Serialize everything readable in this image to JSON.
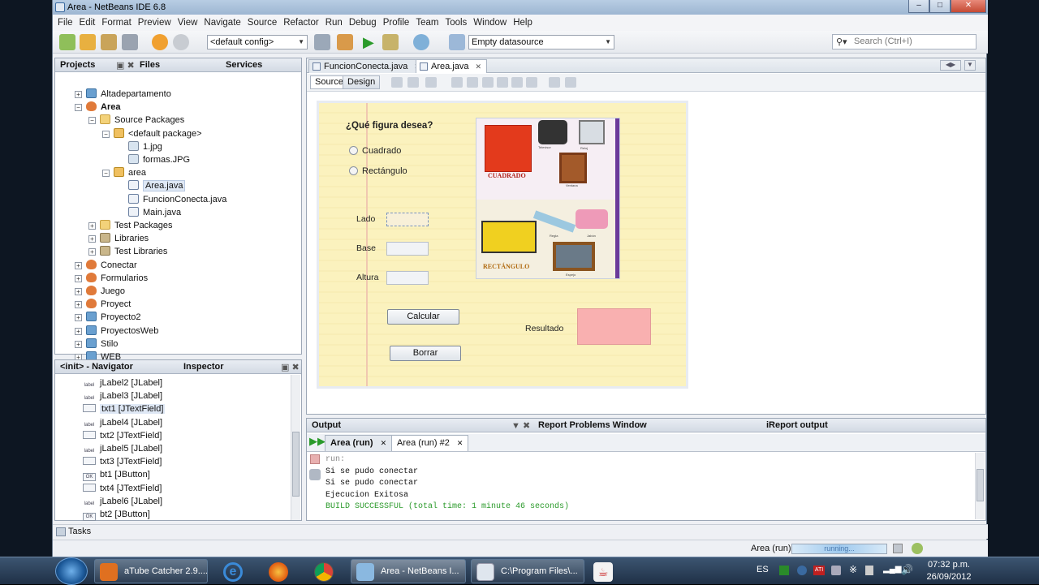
{
  "window": {
    "title": "Area - NetBeans IDE 6.8"
  },
  "menu": [
    "File",
    "Edit",
    "Format",
    "Preview",
    "View",
    "Navigate",
    "Source",
    "Refactor",
    "Run",
    "Debug",
    "Profile",
    "Team",
    "Tools",
    "Window",
    "Help"
  ],
  "toolbar": {
    "config": "<default config>",
    "datasource": "Empty datasource",
    "search_placeholder": "Search (Ctrl+I)"
  },
  "projects_panel": {
    "tabs": [
      "Projects",
      "Files",
      "Services"
    ],
    "tree": [
      {
        "label": "Altadepartamento",
        "icon": "project-icon"
      },
      {
        "label": "Area",
        "icon": "coffee-cup-icon",
        "bold": true
      },
      {
        "label": "Source Packages",
        "icon": "source-packages-icon"
      },
      {
        "label": "<default package>",
        "icon": "package-icon"
      },
      {
        "label": "1.jpg",
        "icon": "image-file-icon"
      },
      {
        "label": "formas.JPG",
        "icon": "image-file-icon"
      },
      {
        "label": "area",
        "icon": "package-icon"
      },
      {
        "label": "Area.java",
        "icon": "java-file-icon",
        "selected": true
      },
      {
        "label": "FuncionConecta.java",
        "icon": "java-file-icon"
      },
      {
        "label": "Main.java",
        "icon": "java-file-icon"
      },
      {
        "label": "Test Packages",
        "icon": "test-packages-icon"
      },
      {
        "label": "Libraries",
        "icon": "libraries-icon"
      },
      {
        "label": "Test Libraries",
        "icon": "libraries-icon"
      },
      {
        "label": "Conectar",
        "icon": "coffee-cup-icon"
      },
      {
        "label": "Formularios",
        "icon": "coffee-cup-icon"
      },
      {
        "label": "Juego",
        "icon": "coffee-cup-icon"
      },
      {
        "label": "Proyect",
        "icon": "coffee-cup-icon"
      },
      {
        "label": "Proyecto2",
        "icon": "project-icon"
      },
      {
        "label": "ProyectosWeb",
        "icon": "project-icon"
      },
      {
        "label": "Stilo",
        "icon": "project-icon"
      },
      {
        "label": "WEB",
        "icon": "project-icon"
      }
    ]
  },
  "navigator": {
    "tabs": [
      "<init> - Navigator",
      "Inspector"
    ],
    "items": [
      {
        "label": "jLabel2 [JLabel]",
        "icon": "label-icon"
      },
      {
        "label": "jLabel3 [JLabel]",
        "icon": "label-icon"
      },
      {
        "label": "txt1 [JTextField]",
        "icon": "textfield-icon",
        "selected": true
      },
      {
        "label": "jLabel4 [JLabel]",
        "icon": "label-icon"
      },
      {
        "label": "txt2 [JTextField]",
        "icon": "textfield-icon"
      },
      {
        "label": "jLabel5 [JLabel]",
        "icon": "label-icon"
      },
      {
        "label": "txt3 [JTextField]",
        "icon": "textfield-icon"
      },
      {
        "label": "bt1 [JButton]",
        "icon": "button-icon"
      },
      {
        "label": "txt4 [JTextField]",
        "icon": "textfield-icon"
      },
      {
        "label": "jLabel6 [JLabel]",
        "icon": "label-icon"
      },
      {
        "label": "bt2 [JButton]",
        "icon": "button-icon"
      }
    ],
    "icon_text": {
      "label": "label",
      "button": "OK"
    }
  },
  "editor": {
    "tabs": [
      "FuncionConecta.java",
      "Area.java"
    ],
    "mode_source": "Source",
    "mode_design": "Design",
    "form": {
      "question": "¿Qué figura desea?",
      "radio1": "Cuadrado",
      "radio2": "Rectángulo",
      "lado": "Lado",
      "base": "Base",
      "altura": "Altura",
      "calcular": "Calcular",
      "borrar": "Borrar",
      "resultado": "Resultado",
      "img_cuadrado": "CUADRADO",
      "img_rectangulo": "RECTÁNGULO",
      "img_labels": [
        "Televisor",
        "Reloj",
        "Ventana",
        "Regla",
        "Jabón",
        "Espejo"
      ]
    }
  },
  "output": {
    "tabs": [
      "Output",
      "Report Problems Window",
      "iReport output"
    ],
    "run_tabs": [
      "Area (run)",
      "Area (run) #2"
    ],
    "lines": [
      {
        "text": "run:",
        "color": "#888888"
      },
      {
        "text": "Si se pudo conectar",
        "color": "#111111"
      },
      {
        "text": "Si se pudo conectar",
        "color": "#111111"
      },
      {
        "text": "Ejecucion Exitosa",
        "color": "#111111"
      },
      {
        "text": "BUILD SUCCESSFUL (total time: 1 minute 46 seconds)",
        "color": "#2a9a2a"
      }
    ]
  },
  "tasks": "Tasks",
  "status": {
    "run_label": "Area (run)",
    "progress_text": "running..."
  },
  "taskbar": {
    "items": [
      "aTube Catcher 2.9....",
      "Area - NetBeans I...",
      "C:\\Program Files\\..."
    ],
    "lang": "ES",
    "time": "07:32 p.m.",
    "date": "26/09/2012"
  }
}
